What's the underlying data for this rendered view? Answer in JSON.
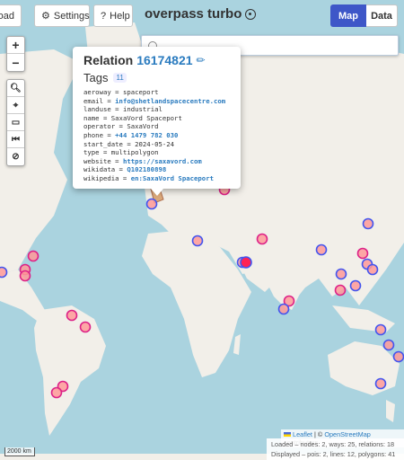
{
  "toolbar": {
    "load_label": "oad",
    "settings_label": "Settings",
    "help_label": "Help"
  },
  "app": {
    "title": "overpass turbo"
  },
  "view_toggle": {
    "map_label": "Map",
    "data_label": "Data"
  },
  "search": {
    "value": "",
    "placeholder": ""
  },
  "zoom": {
    "in_label": "+",
    "out_label": "−"
  },
  "popup": {
    "type_label": "Relation",
    "id": "16174821",
    "tags_heading": "Tags",
    "tag_count": "11",
    "tags": [
      {
        "key": "aeroway",
        "value": "spaceport",
        "link": false
      },
      {
        "key": "email",
        "value": "info@shetlandspacecentre.com",
        "link": true
      },
      {
        "key": "landuse",
        "value": "industrial",
        "link": false
      },
      {
        "key": "name",
        "value": "SaxaVord Spaceport",
        "link": false
      },
      {
        "key": "operator",
        "value": "SaxaVord",
        "link": false
      },
      {
        "key": "phone",
        "value": "+44 1479 782 030",
        "link": true
      },
      {
        "key": "start_date",
        "value": "2024-05-24",
        "link": false
      },
      {
        "key": "type",
        "value": "multipolygon",
        "link": false
      },
      {
        "key": "website",
        "value": "https://saxavord.com",
        "link": true
      },
      {
        "key": "wikidata",
        "value": "Q102180898",
        "link": true
      },
      {
        "key": "wikipedia",
        "value": "en:SaxaVord Spaceport",
        "link": true
      }
    ]
  },
  "scale_label": "2000 km",
  "attribution": {
    "leaflet": "Leaflet",
    "separator": " | © ",
    "osm": "OpenStreetMap",
    "suffix": " contributors"
  },
  "stats": {
    "loaded": "Loaded – nodes: 2, ways: 25, relations: 18",
    "displayed": "Displayed – pois: 2, lines: 12, polygons: 41"
  },
  "colors": {
    "accent": "#3e57c8",
    "marker_fill": "#ff9999",
    "marker_stroke_blue": "#4455ee",
    "marker_stroke_pink": "#dd2288",
    "land": "#f2efe9",
    "water": "#aad3df"
  }
}
